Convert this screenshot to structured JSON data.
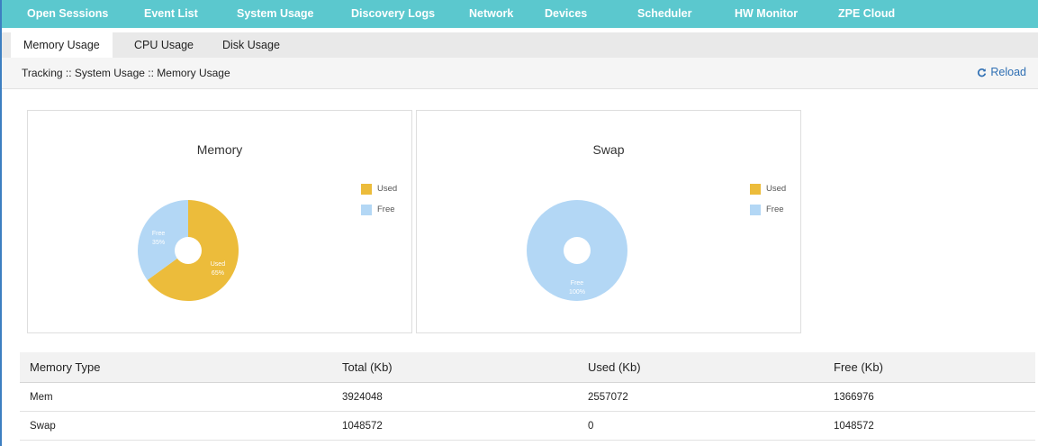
{
  "top_nav": {
    "items": [
      "Open Sessions",
      "Event List",
      "System Usage",
      "Discovery Logs",
      "Network",
      "Devices",
      "Scheduler",
      "HW Monitor",
      "ZPE Cloud"
    ]
  },
  "sub_nav": {
    "tabs": [
      "Memory Usage",
      "CPU Usage",
      "Disk Usage"
    ],
    "active": "Memory Usage"
  },
  "breadcrumb": "Tracking :: System Usage :: Memory Usage",
  "reload_label": "Reload",
  "colors": {
    "used": "#ecbc3b",
    "free": "#b3d7f5",
    "nav": "#5bc8ce",
    "link": "#2f6fb3"
  },
  "charts": [
    {
      "title": "Memory",
      "legend": [
        "Used",
        "Free"
      ],
      "slices": [
        {
          "name": "Used",
          "percent": 65,
          "label_name": "Used",
          "label_value": "65%"
        },
        {
          "name": "Free",
          "percent": 35,
          "label_name": "Free",
          "label_value": "35%"
        }
      ]
    },
    {
      "title": "Swap",
      "legend": [
        "Used",
        "Free"
      ],
      "slices": [
        {
          "name": "Free",
          "percent": 100,
          "label_name": "Free",
          "label_value": "100%"
        }
      ]
    }
  ],
  "table": {
    "headers": [
      "Memory Type",
      "Total (Kb)",
      "Used (Kb)",
      "Free (Kb)"
    ],
    "rows": [
      [
        "Mem",
        "3924048",
        "2557072",
        "1366976"
      ],
      [
        "Swap",
        "1048572",
        "0",
        "1048572"
      ]
    ]
  }
}
